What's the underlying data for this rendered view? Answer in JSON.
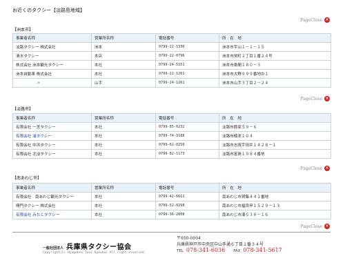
{
  "page": {
    "title": "お近くのタクシー【淡路島地域】"
  },
  "close_label": "PageClose",
  "headers": [
    "事業者名称",
    "営業所名称",
    "電話番号",
    "所　在　地"
  ],
  "sections": [
    {
      "label": "【洲本市】",
      "rows": [
        {
          "name": "淡路タクシー 株式会社",
          "office": "洲本",
          "phone": "0799-22-1330",
          "address": "洲本市宇山１－１－１５"
        },
        {
          "name": "清水タクシー",
          "office": "本店",
          "phone": "0799-22-0796",
          "address": "洲本市栄町２丁目１番２４号"
        },
        {
          "name": "株式会社 洲本観光タクシー",
          "office": "本社",
          "phone": "0799-24-5151",
          "address": "洲本市桑間１８０－３"
        },
        {
          "name": "洲本自動車 株式会社",
          "office": "本社",
          "phone": "0799-22-1261",
          "address": "洲本市大野９９９番地の１"
        },
        {
          "name": "〃",
          "office": "山手",
          "phone": "0799-24-1261",
          "address": "洲本市山手３丁目２－２４"
        }
      ]
    },
    {
      "label": "【淡路市】",
      "rows": [
        {
          "name": "有限会社 一宮タクシー",
          "office": "本社",
          "phone": "0799-85-0232",
          "address": "淡路市郡家５９－６"
        },
        {
          "name": "有限会社 浦タクシー",
          "office": "本社",
          "phone": "0799-74-3188",
          "address": "淡路市楠本１０４"
        },
        {
          "name": "有限会社 中浜タクシー",
          "office": "本社",
          "phone": "0799-62-0250",
          "address": "淡路市志筑宇田井１４２８－１"
        },
        {
          "name": "有限会社 北淡タクシー",
          "office": "本社",
          "phone": "0799-82-1173",
          "address": "淡路市富島１９８４番地"
        }
      ]
    },
    {
      "label": "【南あわじ市】",
      "rows": [
        {
          "name": "有限会社　南あわじ観光タクシー",
          "office": "本社",
          "phone": "0799-42-6611",
          "address": "南あわじ市賀集４４１番地"
        },
        {
          "name": "鳴門タクシー 株式会社",
          "office": "本社",
          "phone": "0799-52-0298",
          "address": "南あわじ市福良甲１５２９－１３"
        },
        {
          "name": "有限会社 みなとタクシー",
          "office": "本社",
          "phone": "0799-36-2808",
          "address": "南あわじ市湊５３６－１６"
        }
      ]
    }
  ],
  "footer": {
    "org_prefix": "一般社団法人",
    "org_name": "兵庫県タクシー協会",
    "copyright": "Copyright(C) Hyogoken Taxi Kyoukai All right reserved.",
    "postal": "〒650-0004",
    "address": "兵庫県神戸市中央区中山手通６丁目１番３４号",
    "tel_label": "TEL",
    "tel": "078-341-6036",
    "fax_label": "FAX",
    "fax": "078-341-5617"
  }
}
